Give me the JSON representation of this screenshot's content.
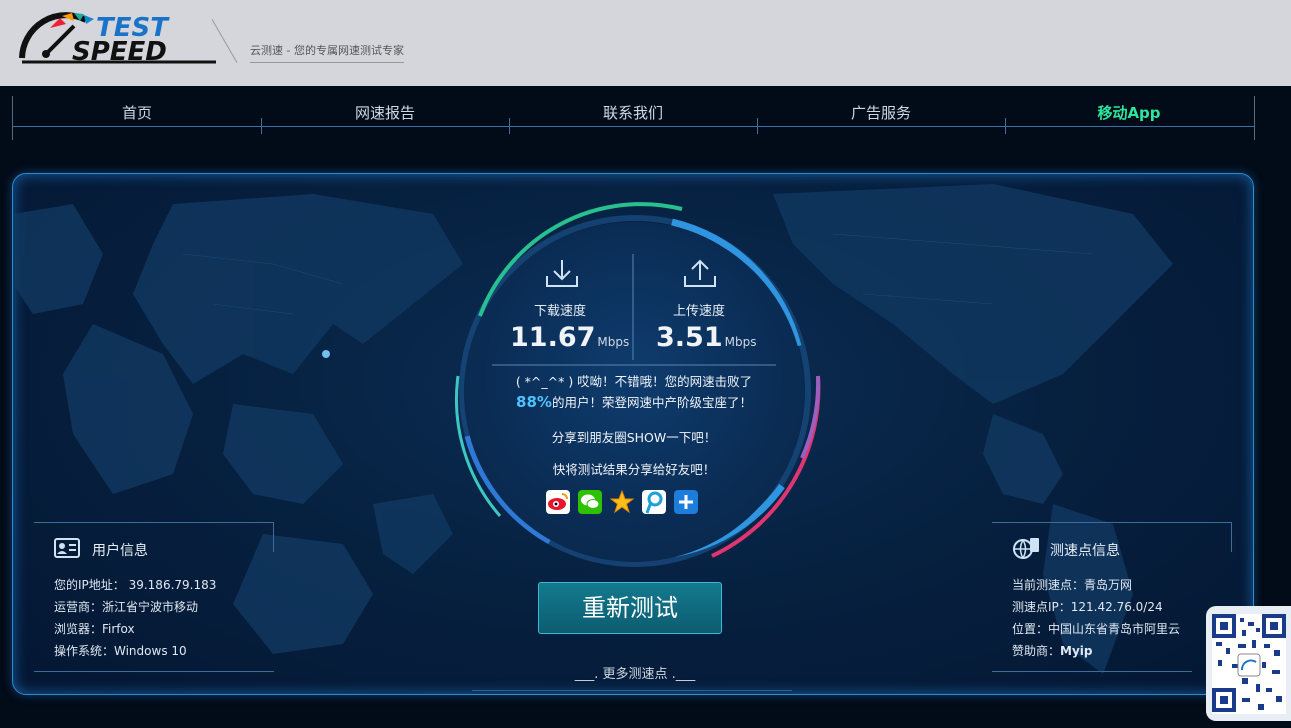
{
  "brand": {
    "logo_line1": "TEST",
    "logo_line2": "SPEED",
    "slogan": "云测速 - 您的专属网速测试专家"
  },
  "nav": {
    "items": [
      "首页",
      "网速报告",
      "联系我们",
      "广告服务",
      "移动App"
    ],
    "active_index": 4
  },
  "result": {
    "download_label": "下载速度",
    "download_value": "11.67",
    "download_unit": "Mbps",
    "upload_label": "上传速度",
    "upload_value": "3.51",
    "upload_unit": "Mbps",
    "message_line1": "( *^_^* ) 哎呦！不错哦！您的网速击败了",
    "beat_percent": "88%",
    "message_line2_suffix": "的用户！荣登网速中产阶级宝座了！",
    "share_line1": "分享到朋友圈SHOW一下吧！",
    "share_line2": "快将测试结果分享给好友吧！",
    "share_icons": [
      "weibo-icon",
      "wechat-icon",
      "qzone-icon",
      "tencent-weibo-icon",
      "more-share-icon"
    ]
  },
  "actions": {
    "retest_label": "重新测试",
    "more_nodes_label": "___. 更多测速点 .___"
  },
  "user_info": {
    "title": "用户信息",
    "ip": "您的IP地址： 39.186.79.183",
    "isp": "运营商：浙江省宁波市移动",
    "browser": "浏览器：Firfox",
    "os": "操作系统：Windows 10"
  },
  "node_info": {
    "title": "测速点信息",
    "current": "当前测速点：青岛万网",
    "ip": "测速点IP：121.42.76.0/24",
    "location": "位置：中国山东省青岛市阿里云",
    "sponsor_prefix": "赞助商：",
    "sponsor": "Myip"
  },
  "colors": {
    "accent_green": "#2ee59d",
    "accent_blue": "#4fc2ff",
    "panel_border": "#2a8bd8",
    "button": "#137a8e"
  }
}
